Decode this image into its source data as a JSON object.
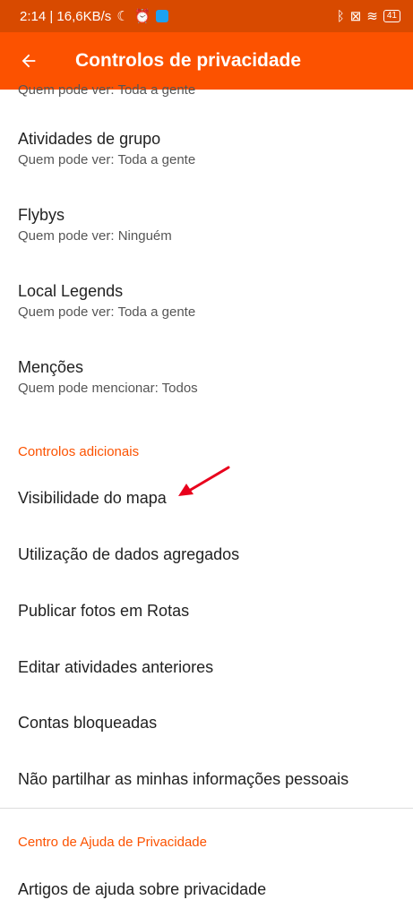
{
  "status_bar": {
    "time_speed": "2:14 | 16,6KB/s",
    "battery": "41"
  },
  "app_bar": {
    "title": "Controlos de privacidade"
  },
  "cutoff_text": "Quem pode ver: Toda a gente",
  "items": [
    {
      "title": "Atividades de grupo",
      "subtitle": "Quem pode ver: Toda a gente"
    },
    {
      "title": "Flybys",
      "subtitle": "Quem pode ver: Ninguém"
    },
    {
      "title": "Local Legends",
      "subtitle": "Quem pode ver: Toda a gente"
    },
    {
      "title": "Menções",
      "subtitle": "Quem pode mencionar: Todos"
    }
  ],
  "additional_section": {
    "header": "Controlos adicionais",
    "items": [
      "Visibilidade do mapa",
      "Utilização de dados agregados",
      "Publicar fotos em Rotas",
      "Editar atividades anteriores",
      "Contas bloqueadas",
      "Não partilhar as minhas informações pessoais"
    ]
  },
  "help_section": {
    "header": "Centro de Ajuda de Privacidade",
    "items": [
      "Artigos de ajuda sobre privacidade"
    ]
  },
  "colors": {
    "accent": "#fc5200",
    "statusbar": "#d84a00",
    "annotation": "#e8001c"
  }
}
